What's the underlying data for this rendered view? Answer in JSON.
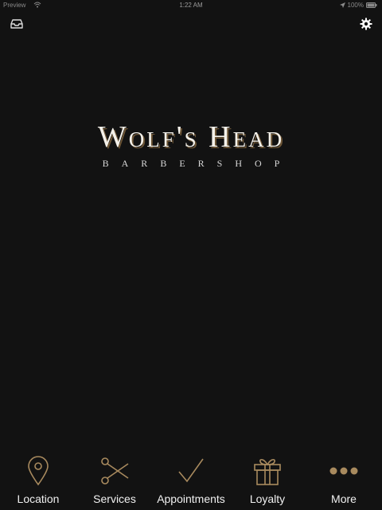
{
  "status_bar": {
    "carrier": "Preview",
    "time": "1:22 AM",
    "battery": "100%"
  },
  "header": {
    "left_icon": "inbox-icon",
    "right_icon": "gear-icon"
  },
  "logo": {
    "title": "Wolf's Head",
    "subtitle": "BARBERSHOP"
  },
  "tabbar": {
    "accent_color": "#a88a5e",
    "items": [
      {
        "label": "Location",
        "icon": "location-pin-icon"
      },
      {
        "label": "Services",
        "icon": "scissors-icon"
      },
      {
        "label": "Appointments",
        "icon": "checkmark-icon"
      },
      {
        "label": "Loyalty",
        "icon": "gift-icon"
      },
      {
        "label": "More",
        "icon": "more-dots-icon"
      }
    ]
  }
}
